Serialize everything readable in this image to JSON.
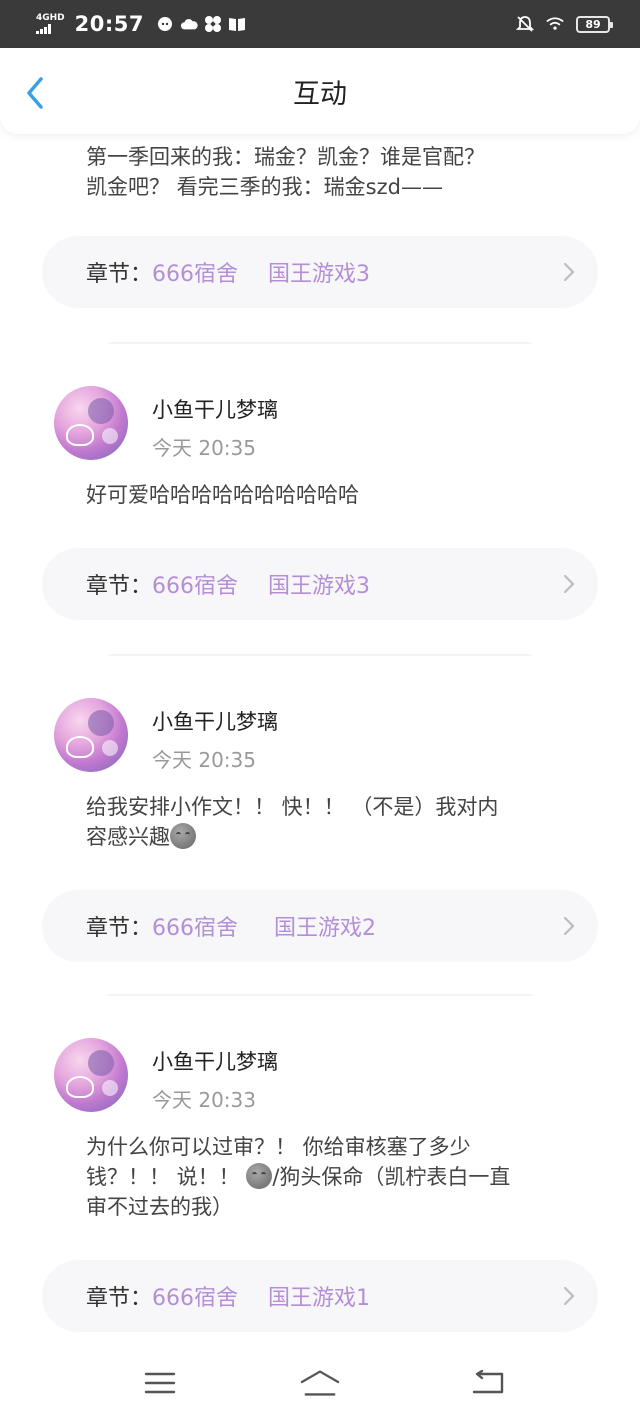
{
  "status_bar": {
    "network": "4GHD",
    "time": "20:57",
    "battery": "89",
    "icons": [
      "wechat-icon",
      "cloud-icon",
      "fan-icon",
      "book-icon",
      "mute-bell-icon",
      "wifi-icon"
    ]
  },
  "header": {
    "title": "互动",
    "back_icon": "chevron-left-icon"
  },
  "partial_comment": {
    "text_line1": "第一季回来的我：瑞金？凯金？谁是官配？",
    "text_line2": "凯金吧？ 看完三季的我：瑞金szd——",
    "chapter": {
      "label": "章节：",
      "book": "666宿舍",
      "name": "国王游戏3"
    }
  },
  "comments": [
    {
      "user": "小鱼干儿梦璃",
      "time": "今天 20:35",
      "text_lines": [
        "好可爱哈哈哈哈哈哈哈哈哈哈"
      ],
      "chapter": {
        "label": "章节：",
        "book": "666宿舍",
        "name": "国王游戏3"
      }
    },
    {
      "user": "小鱼干儿梦璃",
      "time": "今天 20:35",
      "text_lines": [
        "给我安排小作文！！ 快！！ （不是）我对内",
        "容感兴趣"
      ],
      "chapter": {
        "label": "章节：",
        "book": "666宿舍",
        "name": "国王游戏2"
      }
    },
    {
      "user": "小鱼干儿梦璃",
      "time": "今天 20:33",
      "text_lines": [
        "为什么你可以过审？！ 你给审核塞了多少",
        "钱？！！ 说！！ ",
        "/狗头保命（凯柠表白一直",
        "审不过去的我）"
      ],
      "chapter": {
        "label": "章节：",
        "book": "666宿舍",
        "name": "国王游戏1"
      }
    }
  ],
  "colors": {
    "accent": "#3aa0e6",
    "chapter_link": "#b48fd6",
    "status_bar": "#3a3a3a"
  },
  "nav_bar": {
    "icons": [
      "menu-icon",
      "home-icon",
      "back-icon"
    ]
  }
}
